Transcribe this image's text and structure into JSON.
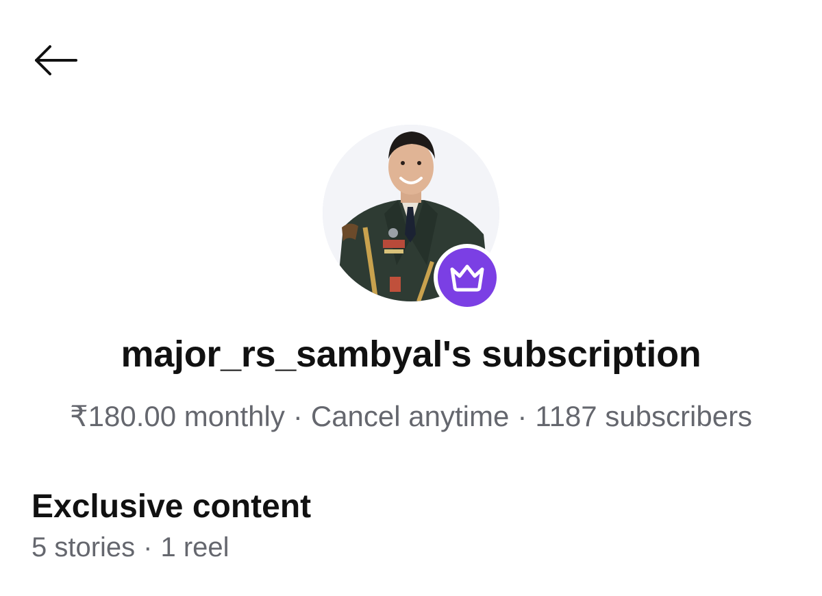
{
  "header": {
    "back_icon": "arrow-left-icon"
  },
  "profile": {
    "avatar_alt": "major_rs_sambyal profile photo",
    "badge_icon": "crown-icon",
    "badge_color": "#7b3fe4",
    "title": "major_rs_sambyal's subscription"
  },
  "subscription": {
    "price": "₹180.00 monthly",
    "separator": "·",
    "cancel": "Cancel anytime",
    "subscribers": "1187 subscribers"
  },
  "exclusive": {
    "title": "Exclusive content",
    "stories": "5 stories",
    "separator": "·",
    "reels": "1 reel"
  }
}
